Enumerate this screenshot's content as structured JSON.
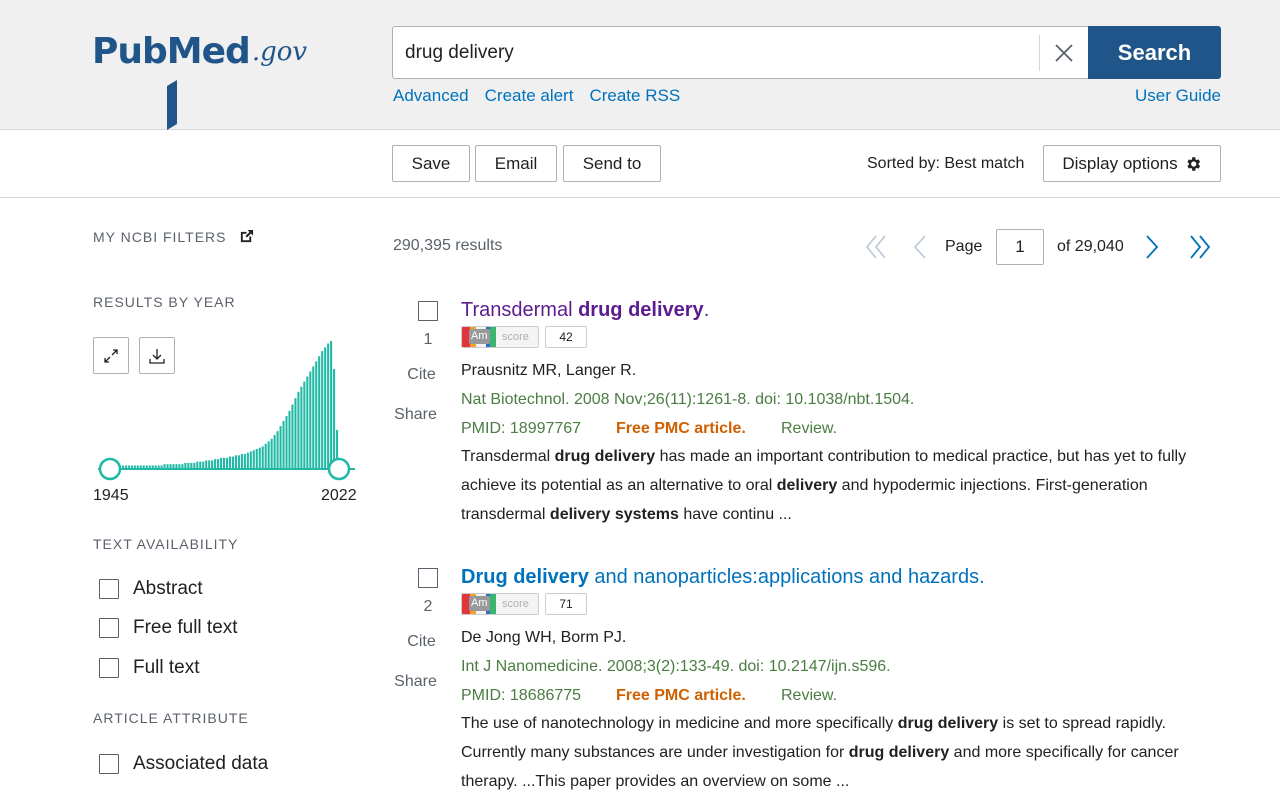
{
  "header": {
    "logo_pub": "Pub",
    "logo_med": "Med",
    "logo_gov": ".gov",
    "search_value": "drug delivery",
    "search_button": "Search",
    "links": [
      "Advanced",
      "Create alert",
      "Create RSS"
    ],
    "user_guide": "User Guide"
  },
  "actionbar": {
    "save": "Save",
    "email": "Email",
    "send_to": "Send to",
    "sorted_by": "Sorted by: Best match",
    "display_options": "Display options"
  },
  "sidebar": {
    "my_ncbi_filters": "MY NCBI FILTERS",
    "results_by_year": "RESULTS BY YEAR",
    "year_start": "1945",
    "year_end": "2022",
    "text_availability": "TEXT AVAILABILITY",
    "text_filters": [
      "Abstract",
      "Free full text",
      "Full text"
    ],
    "article_attribute": "ARTICLE ATTRIBUTE",
    "attribute_filters": [
      "Associated data"
    ]
  },
  "chart_data": {
    "type": "bar",
    "x_range": [
      1945,
      2022
    ],
    "values_relative": [
      0.02,
      0.02,
      0.02,
      0.02,
      0.02,
      0.02,
      0.02,
      0.02,
      0.02,
      0.02,
      0.02,
      0.02,
      0.02,
      0.02,
      0.02,
      0.02,
      0.02,
      0.02,
      0.03,
      0.03,
      0.03,
      0.03,
      0.03,
      0.03,
      0.03,
      0.04,
      0.04,
      0.04,
      0.04,
      0.05,
      0.05,
      0.05,
      0.06,
      0.06,
      0.06,
      0.07,
      0.07,
      0.08,
      0.08,
      0.08,
      0.09,
      0.09,
      0.1,
      0.1,
      0.11,
      0.11,
      0.12,
      0.13,
      0.14,
      0.15,
      0.16,
      0.17,
      0.19,
      0.21,
      0.23,
      0.26,
      0.29,
      0.33,
      0.37,
      0.41,
      0.45,
      0.5,
      0.55,
      0.6,
      0.64,
      0.68,
      0.72,
      0.76,
      0.8,
      0.84,
      0.88,
      0.92,
      0.95,
      0.98,
      1.0,
      0.78,
      0.3
    ]
  },
  "results": {
    "count": "290,395 results",
    "page_label": "Page",
    "page_value": "1",
    "of_pages": "of 29,040",
    "items": [
      {
        "num": "1",
        "cite": "Cite",
        "share": "Share",
        "title_pre": "Transdermal ",
        "title_bold": "drug delivery",
        "title_post": ".",
        "altmetric_am": "Am",
        "altmetric_label": "score",
        "altmetric_score": "42",
        "authors": "Prausnitz MR, Langer R.",
        "journal": "Nat Biotechnol. 2008 Nov;26(11):1261-8. doi: 10.1038/nbt.1504.",
        "pmid": "PMID: 18997767",
        "free": "Free PMC article.",
        "review": "Review.",
        "snippet": [
          {
            "t": "Transdermal ",
            "b": false
          },
          {
            "t": "drug delivery",
            "b": true
          },
          {
            "t": " has made an important contribution to medical practice, but has yet to fully achieve its potential as an alternative to oral ",
            "b": false
          },
          {
            "t": "delivery",
            "b": true
          },
          {
            "t": " and hypodermic injections. First-generation transdermal ",
            "b": false
          },
          {
            "t": "delivery systems",
            "b": true
          },
          {
            "t": " have continu ...",
            "b": false
          }
        ]
      },
      {
        "num": "2",
        "cite": "Cite",
        "share": "Share",
        "title_pre": "",
        "title_bold": "Drug delivery",
        "title_post": " and nanoparticles:applications and hazards.",
        "altmetric_am": "Am",
        "altmetric_label": "score",
        "altmetric_score": "71",
        "authors": "De Jong WH, Borm PJ.",
        "journal": "Int J Nanomedicine. 2008;3(2):133-49. doi: 10.2147/ijn.s596.",
        "pmid": "PMID: 18686775",
        "free": "Free PMC article.",
        "review": "Review.",
        "snippet": [
          {
            "t": "The use of nanotechnology in medicine and more specifically ",
            "b": false
          },
          {
            "t": "drug delivery",
            "b": true
          },
          {
            "t": " is set to spread rapidly. Currently many substances are under investigation for ",
            "b": false
          },
          {
            "t": "drug delivery",
            "b": true
          },
          {
            "t": " and more specifically for cancer therapy. ...This paper provides an overview on some ...",
            "b": false
          }
        ]
      }
    ]
  },
  "colors": {
    "brand": "#20558a",
    "link": "#0071bc",
    "visited": "#5c1b8e",
    "journal": "#4b7d43",
    "free_pmc": "#d05f00",
    "chart": "#20b9a6"
  }
}
